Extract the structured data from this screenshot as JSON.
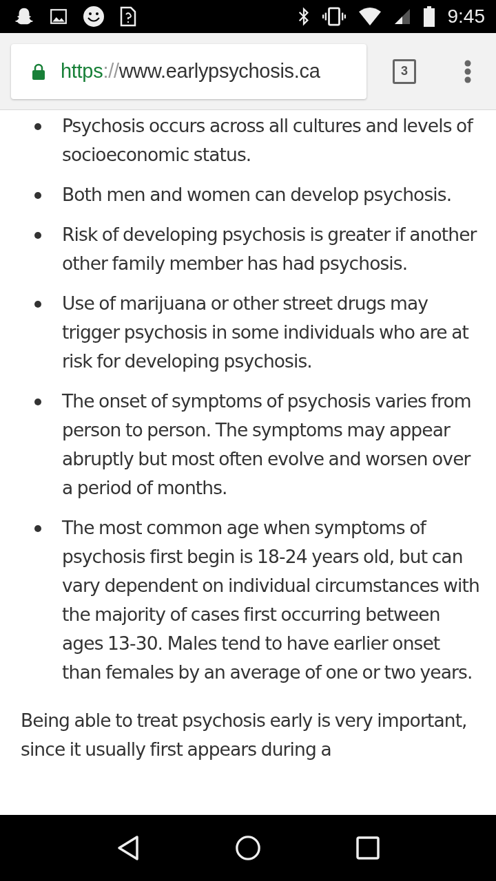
{
  "status_bar": {
    "time": "9:45"
  },
  "address_bar": {
    "scheme": "https",
    "separator": "://",
    "host": "www.earlypsychosis.ca",
    "tab_count": "3"
  },
  "bullets": [
    "Psychosis occurs across all cultures and levels of socioeconomic status.",
    "Both men and women can develop psychosis.",
    "Risk of developing psychosis is greater if another other family member has had psychosis.",
    "Use of marijuana or other street drugs may trigger psychosis in some individuals who are at risk for developing psychosis.",
    "The onset of symptoms of psychosis varies from person to person. The symptoms may appear abruptly  but most often evolve and worsen over a period of months.",
    "The most common age when symptoms of psychosis first begin is 18-24 years old, but can vary dependent on individual circumstances with the majority of cases first occurring between ages 13-30. Males tend to have earlier onset than females by an average of one or two years."
  ],
  "paragraph": "Being able to treat psychosis early is very important, since it usually first appears during a"
}
